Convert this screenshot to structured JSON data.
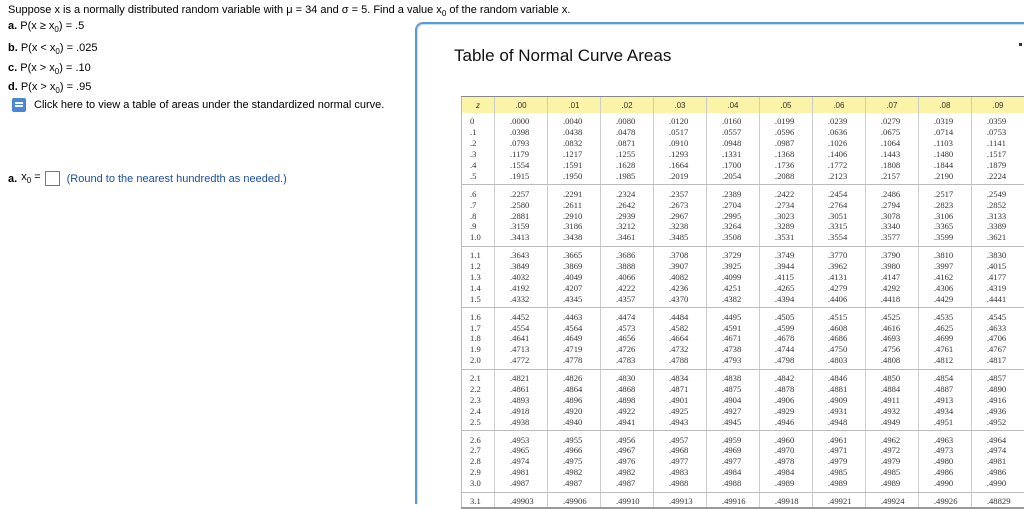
{
  "question": {
    "intro_pre": "Suppose x is a normally distributed random variable with μ = 34 and σ = 5. Find a value x",
    "intro_sub": "0",
    "intro_post": " of the random variable x.",
    "parts": [
      {
        "label": "a.",
        "pre": "P(x ≥ x",
        "sub": "0",
        "post": ") = .5"
      },
      {
        "label": "b.",
        "pre": "P(x < x",
        "sub": "0",
        "post": ") = .025"
      },
      {
        "label": "c.",
        "pre": "P(x > x",
        "sub": "0",
        "post": ") = .10"
      },
      {
        "label": "d.",
        "pre": "P(x > x",
        "sub": "0",
        "post": ") = .95"
      }
    ],
    "link_text": "Click here to view a table of areas under the standardized normal curve.",
    "answer": {
      "label": "a.",
      "var": "x",
      "sub": "0",
      "eq": " =",
      "value": "",
      "hint": "(Round to the nearest hundredth as needed.)"
    }
  },
  "panel": {
    "title": "Table of Normal Curve Areas"
  },
  "table": {
    "headers": [
      "z",
      ".00",
      ".01",
      ".02",
      ".03",
      ".04",
      ".05",
      ".06",
      ".07",
      ".08",
      ".09"
    ],
    "rows": [
      [
        "0",
        ".0000",
        ".0040",
        ".0080",
        ".0120",
        ".0160",
        ".0199",
        ".0239",
        ".0279",
        ".0319",
        ".0359"
      ],
      [
        ".1",
        ".0398",
        ".0438",
        ".0478",
        ".0517",
        ".0557",
        ".0596",
        ".0636",
        ".0675",
        ".0714",
        ".0753"
      ],
      [
        ".2",
        ".0793",
        ".0832",
        ".0871",
        ".0910",
        ".0948",
        ".0987",
        ".1026",
        ".1064",
        ".1103",
        ".1141"
      ],
      [
        ".3",
        ".1179",
        ".1217",
        ".1255",
        ".1293",
        ".1331",
        ".1368",
        ".1406",
        ".1443",
        ".1480",
        ".1517"
      ],
      [
        ".4",
        ".1554",
        ".1591",
        ".1628",
        ".1664",
        ".1700",
        ".1736",
        ".1772",
        ".1808",
        ".1844",
        ".1879"
      ],
      [
        ".5",
        ".1915",
        ".1950",
        ".1985",
        ".2019",
        ".2054",
        ".2088",
        ".2123",
        ".2157",
        ".2190",
        ".2224"
      ],
      [
        ".6",
        ".2257",
        ".2291",
        ".2324",
        ".2357",
        ".2389",
        ".2422",
        ".2454",
        ".2486",
        ".2517",
        ".2549"
      ],
      [
        ".7",
        ".2580",
        ".2611",
        ".2642",
        ".2673",
        ".2704",
        ".2734",
        ".2764",
        ".2794",
        ".2823",
        ".2852"
      ],
      [
        ".8",
        ".2881",
        ".2910",
        ".2939",
        ".2967",
        ".2995",
        ".3023",
        ".3051",
        ".3078",
        ".3106",
        ".3133"
      ],
      [
        ".9",
        ".3159",
        ".3186",
        ".3212",
        ".3238",
        ".3264",
        ".3289",
        ".3315",
        ".3340",
        ".3365",
        ".3389"
      ],
      [
        "1.0",
        ".3413",
        ".3438",
        ".3461",
        ".3485",
        ".3508",
        ".3531",
        ".3554",
        ".3577",
        ".3599",
        ".3621"
      ],
      [
        "1.1",
        ".3643",
        ".3665",
        ".3686",
        ".3708",
        ".3729",
        ".3749",
        ".3770",
        ".3790",
        ".3810",
        ".3830"
      ],
      [
        "1.2",
        ".3849",
        ".3869",
        ".3888",
        ".3907",
        ".3925",
        ".3944",
        ".3962",
        ".3980",
        ".3997",
        ".4015"
      ],
      [
        "1.3",
        ".4032",
        ".4049",
        ".4066",
        ".4082",
        ".4099",
        ".4115",
        ".4131",
        ".4147",
        ".4162",
        ".4177"
      ],
      [
        "1.4",
        ".4192",
        ".4207",
        ".4222",
        ".4236",
        ".4251",
        ".4265",
        ".4279",
        ".4292",
        ".4306",
        ".4319"
      ],
      [
        "1.5",
        ".4332",
        ".4345",
        ".4357",
        ".4370",
        ".4382",
        ".4394",
        ".4406",
        ".4418",
        ".4429",
        ".4441"
      ],
      [
        "1.6",
        ".4452",
        ".4463",
        ".4474",
        ".4484",
        ".4495",
        ".4505",
        ".4515",
        ".4525",
        ".4535",
        ".4545"
      ],
      [
        "1.7",
        ".4554",
        ".4564",
        ".4573",
        ".4582",
        ".4591",
        ".4599",
        ".4608",
        ".4616",
        ".4625",
        ".4633"
      ],
      [
        "1.8",
        ".4641",
        ".4649",
        ".4656",
        ".4664",
        ".4671",
        ".4678",
        ".4686",
        ".4693",
        ".4699",
        ".4706"
      ],
      [
        "1.9",
        ".4713",
        ".4719",
        ".4726",
        ".4732",
        ".4738",
        ".4744",
        ".4750",
        ".4756",
        ".4761",
        ".4767"
      ],
      [
        "2.0",
        ".4772",
        ".4778",
        ".4783",
        ".4788",
        ".4793",
        ".4798",
        ".4803",
        ".4808",
        ".4812",
        ".4817"
      ],
      [
        "2.1",
        ".4821",
        ".4826",
        ".4830",
        ".4834",
        ".4838",
        ".4842",
        ".4846",
        ".4850",
        ".4854",
        ".4857"
      ],
      [
        "2.2",
        ".4861",
        ".4864",
        ".4868",
        ".4871",
        ".4875",
        ".4878",
        ".4881",
        ".4884",
        ".4887",
        ".4890"
      ],
      [
        "2.3",
        ".4893",
        ".4896",
        ".4898",
        ".4901",
        ".4904",
        ".4906",
        ".4909",
        ".4911",
        ".4913",
        ".4916"
      ],
      [
        "2.4",
        ".4918",
        ".4920",
        ".4922",
        ".4925",
        ".4927",
        ".4929",
        ".4931",
        ".4932",
        ".4934",
        ".4936"
      ],
      [
        "2.5",
        ".4938",
        ".4940",
        ".4941",
        ".4943",
        ".4945",
        ".4946",
        ".4948",
        ".4949",
        ".4951",
        ".4952"
      ],
      [
        "2.6",
        ".4953",
        ".4955",
        ".4956",
        ".4957",
        ".4959",
        ".4960",
        ".4961",
        ".4962",
        ".4963",
        ".4964"
      ],
      [
        "2.7",
        ".4965",
        ".4966",
        ".4967",
        ".4968",
        ".4969",
        ".4970",
        ".4971",
        ".4972",
        ".4973",
        ".4974"
      ],
      [
        "2.8",
        ".4974",
        ".4975",
        ".4976",
        ".4977",
        ".4977",
        ".4978",
        ".4979",
        ".4979",
        ".4980",
        ".4981"
      ],
      [
        "2.9",
        ".4981",
        ".4982",
        ".4982",
        ".4983",
        ".4984",
        ".4984",
        ".4985",
        ".4985",
        ".4986",
        ".4986"
      ],
      [
        "3.0",
        ".4987",
        ".4987",
        ".4987",
        ".4988",
        ".4988",
        ".4989",
        ".4989",
        ".4989",
        ".4990",
        ".4990"
      ],
      [
        "3.1",
        ".49903",
        ".49906",
        ".49910",
        ".49913",
        ".49916",
        ".49918",
        ".49921",
        ".49924",
        ".49926",
        ".48829"
      ]
    ]
  }
}
